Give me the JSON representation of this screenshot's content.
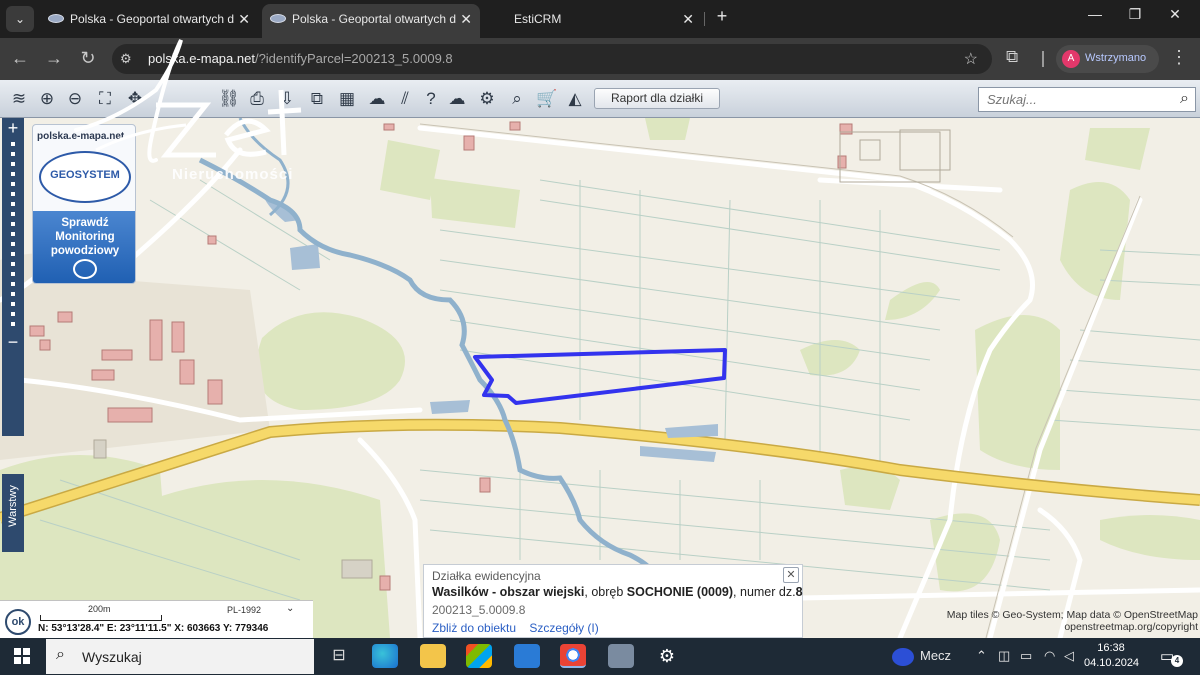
{
  "browser": {
    "tabs": [
      {
        "title": "Polska - Geoportal otwartych d",
        "state": "inactive"
      },
      {
        "title": "Polska - Geoportal otwartych d",
        "state": "active"
      },
      {
        "title": "EstiCRM",
        "state": "inactive"
      }
    ],
    "tab_close_glyph": "✕",
    "new_tab_glyph": "+",
    "window_controls": {
      "minimize": "—",
      "maximize": "❐",
      "close": "✕"
    },
    "url_host": "polska.e-mapa.net",
    "url_path": "/?identifyParcel=200213_5.0009.8",
    "profile_initial": "A",
    "profile_label": "Wstrzymano",
    "accent_color": "#e3386b"
  },
  "map_toolbar": {
    "report_button": "Raport dla działki",
    "search_placeholder": "Szukaj..."
  },
  "side_panel": {
    "site_label": "polska.e-mapa.net",
    "logo_text": "GEOSYSTEM",
    "flood_lines": [
      "Sprawdź",
      "Monitoring",
      "powodziowy"
    ],
    "layers_label": "Warstwy"
  },
  "watermark": {
    "script_text": "Azet",
    "subtitle": "Nieruchomości"
  },
  "parcel_popup": {
    "header": "Działka ewidencyjna",
    "place": "Wasilków - obszar wiejski",
    "obreb_prefix": ", obręb ",
    "obreb": "SOCHONIE (0009)",
    "numer_prefix": ", numer dz.",
    "numer": "8",
    "code": "200213_5.0009.8",
    "link_zoom": "Zbliż do obiektu",
    "link_details": "Szczegóły (I)",
    "close_glyph": "✕"
  },
  "attribution": {
    "line1": "Map tiles © Geo-System; Map data © OpenStreetMap",
    "line2": "openstreetmap.org/copyright"
  },
  "scale": {
    "ok_label": "ok",
    "scale_label": "200m",
    "crs": "PL-1992",
    "coords": "N: 53°13'28.4\" E: 23°11'11.5\"  X: 603663     Y: 779346"
  },
  "taskbar": {
    "search_text": "Wyszukaj",
    "weather": "Mecz",
    "time": "16:38",
    "date": "04.10.2024",
    "notifications": "4"
  },
  "colors": {
    "parcel_outline": "#3333ee",
    "main_road": "#f6d96a",
    "river": "#8fb1cc",
    "field_green": "#dde6c0"
  }
}
